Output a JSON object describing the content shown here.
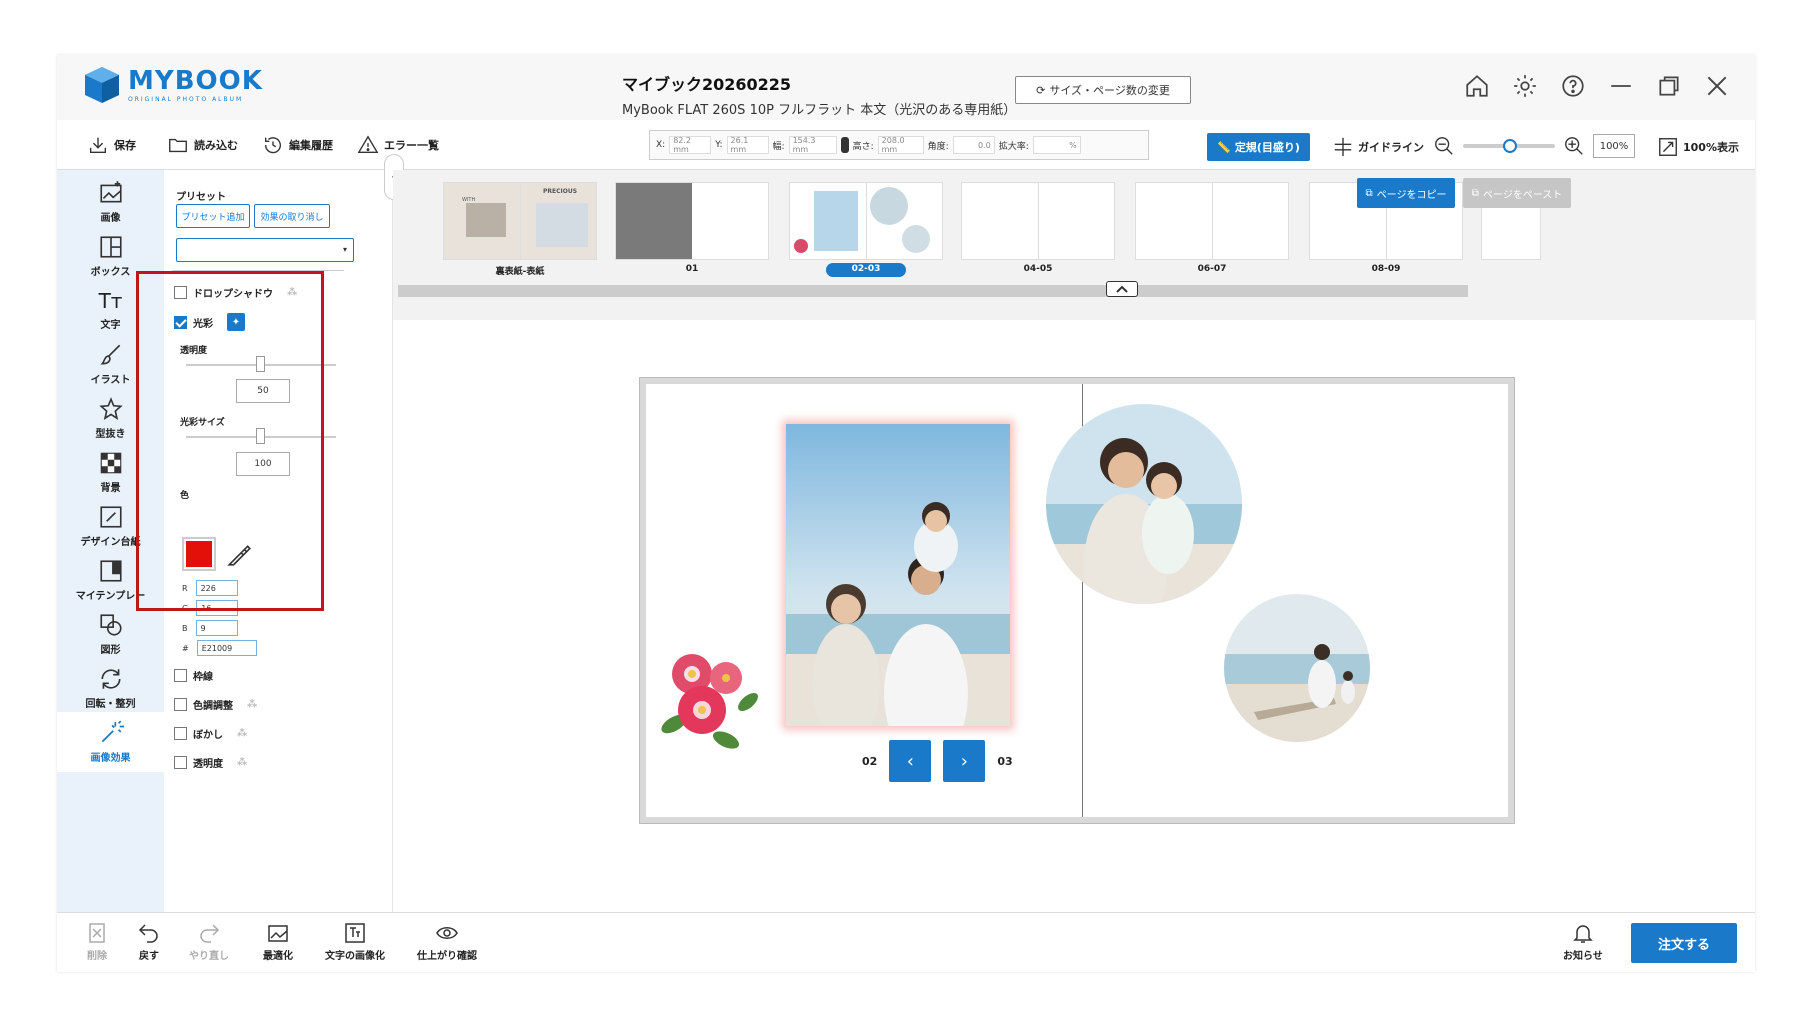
{
  "app": {
    "logo_text": "MYBOOK",
    "logo_sub": "ORIGINAL PHOTO ALBUM",
    "book_title": "マイブック20260225",
    "book_subtitle": "MyBook FLAT 260S 10P フルフラット 本文（光沢のある専用紙）",
    "size_change_label": "サイズ・ページ数の変更"
  },
  "toolbar": {
    "save": "保存",
    "load": "読み込む",
    "history": "編集履歴",
    "errors": "エラー一覧",
    "x_label": "X:",
    "x_value": "82.2 mm",
    "y_label": "Y:",
    "y_value": "26.1 mm",
    "w_label": "幅:",
    "w_value": "154.3 mm",
    "h_label": "高さ:",
    "h_value": "208.0 mm",
    "angle_label": "角度:",
    "angle_value": "0.0",
    "scale_label": "拡大率:",
    "scale_value": "%",
    "ruler_label": "定規(目盛り)",
    "guide_label": "ガイドライン",
    "zoom_value": "100%",
    "fit_label": "100%表示"
  },
  "sidebar": {
    "items": [
      {
        "label": "画像"
      },
      {
        "label": "ボックス"
      },
      {
        "label": "文字"
      },
      {
        "label": "イラスト"
      },
      {
        "label": "型抜き"
      },
      {
        "label": "背景"
      },
      {
        "label": "デザイン台紙"
      },
      {
        "label": "マイテンプレー"
      },
      {
        "label": "図形"
      },
      {
        "label": "回転・整列"
      },
      {
        "label": "画像効果"
      }
    ]
  },
  "panel": {
    "preset_label": "プリセット",
    "add_preset": "プリセット追加",
    "clear_effect": "効果の取り消し",
    "drop_shadow": "ドロップシャドウ",
    "glow": "光彩",
    "opacity_label": "透明度",
    "opacity_value": "50",
    "glow_size_label": "光彩サイズ",
    "glow_size_value": "100",
    "color_label": "色",
    "r_label": "R",
    "r_value": "226",
    "g_label": "G",
    "g_value": "16",
    "b_label": "B",
    "b_value": "9",
    "hex_label": "#",
    "hex_value": "E21009",
    "border": "枠線",
    "color_adjust": "色調調整",
    "blur": "ぼかし",
    "transparency": "透明度"
  },
  "thumbnails": {
    "items": [
      {
        "label": "裏表紙-表紙"
      },
      {
        "label": "01"
      },
      {
        "label": "02-03"
      },
      {
        "label": "04-05"
      },
      {
        "label": "06-07"
      },
      {
        "label": "08-09"
      }
    ],
    "cover_text_1": "PRECIOUS",
    "cover_text_2": "WITH",
    "copy_page": "ページをコピー",
    "paste_page": "ページをペースト"
  },
  "pager": {
    "left_page": "02",
    "right_page": "03"
  },
  "bottom": {
    "delete": "削除",
    "undo": "戻す",
    "redo": "やり直し",
    "optimize": "最適化",
    "text_to_image": "文字の画像化",
    "preview": "仕上がり確認",
    "notice": "お知らせ",
    "order": "注文する"
  },
  "colors": {
    "accent": "#1a7ac9",
    "glow_color": "#e21009",
    "highlight": "#c4141b"
  }
}
